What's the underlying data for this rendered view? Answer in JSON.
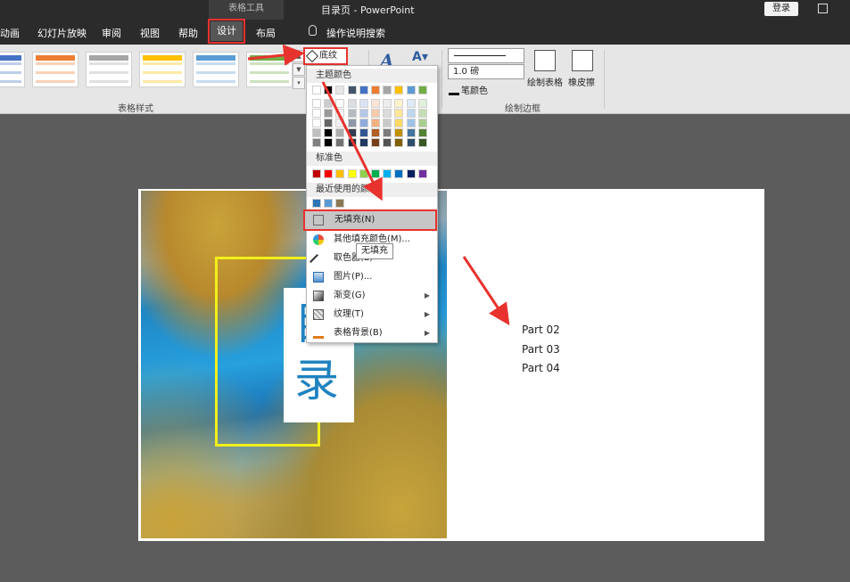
{
  "titlebar": {
    "context_tab": "表格工具",
    "title": "目录页 - PowerPoint",
    "login": "登录"
  },
  "tabs": [
    {
      "label": "动画"
    },
    {
      "label": "幻灯片放映"
    },
    {
      "label": "审阅"
    },
    {
      "label": "视图"
    },
    {
      "label": "帮助"
    },
    {
      "label": "设计"
    },
    {
      "label": "布局"
    }
  ],
  "search_tab": "操作说明搜索",
  "ribbon": {
    "table_styles_label": "表格样式",
    "shading_button": "底纹",
    "pen_weight": "1.0 磅",
    "pen_color": "笔颜色",
    "draw_table": "绘制表格",
    "eraser": "橡皮擦",
    "draw_borders_label": "绘制边框",
    "table_style_colors": [
      "#4472c4",
      "#ed7d31",
      "#a5a5a5",
      "#ffc000",
      "#5b9bd5",
      "#70ad47"
    ]
  },
  "menu": {
    "theme_colors_label": "主题颜色",
    "standard_colors_label": "标准色",
    "recent_colors_label": "最近使用的颜色",
    "theme_colors": [
      "#ffffff",
      "#000000",
      "#e7e6e6",
      "#44546a",
      "#4472c4",
      "#ed7d31",
      "#a5a5a5",
      "#ffc000",
      "#5b9bd5",
      "#70ad47"
    ],
    "standard_colors": [
      "#c00000",
      "#ff0000",
      "#ffc000",
      "#ffff00",
      "#92d050",
      "#00b050",
      "#00b0f0",
      "#0070c0",
      "#002060",
      "#7030a0"
    ],
    "recent_colors": [
      "#2e75b6",
      "#5b9bd5",
      "#8c7853"
    ],
    "items": [
      {
        "label": "无填充(N)"
      },
      {
        "label": "其他填充颜色(M)..."
      },
      {
        "label": "取色器(E)"
      },
      {
        "label": "图片(P)..."
      },
      {
        "label": "渐变(G)"
      },
      {
        "label": "纹理(T)"
      },
      {
        "label": "表格背景(B)"
      }
    ],
    "tooltip": "无填充"
  },
  "slide": {
    "title_chars": [
      "目",
      "录"
    ],
    "parts": [
      "Part 02",
      "Part 03",
      "Part 04"
    ]
  }
}
